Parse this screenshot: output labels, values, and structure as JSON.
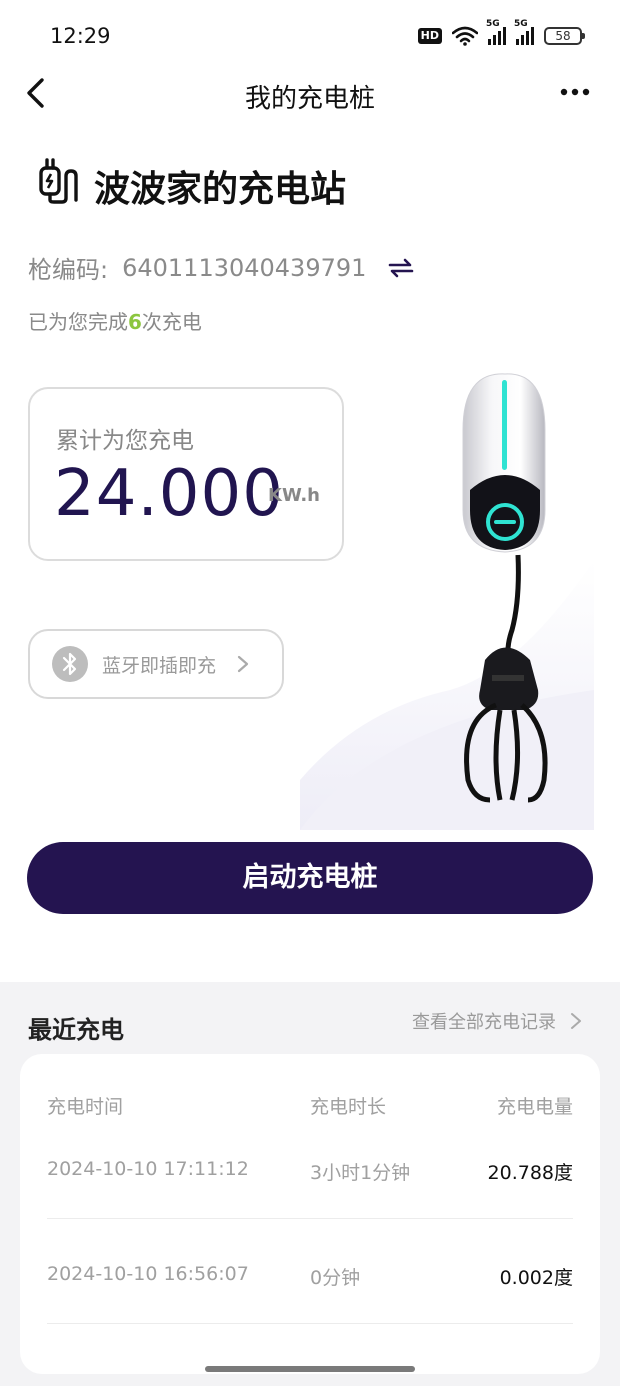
{
  "status_bar": {
    "time": "12:29",
    "hd_badge": "HD",
    "signal_1_tag": "5G",
    "signal_2_tag": "5G",
    "battery": "58",
    "icons": [
      "hd-icon",
      "wifi-icon",
      "signal-icon",
      "signal-icon",
      "battery-icon"
    ]
  },
  "nav": {
    "title": "我的充电桩",
    "back_icon": "chevron-left-icon",
    "more_icon": "more-dots-icon"
  },
  "station": {
    "icon": "charger-plug-icon",
    "name": "波波家的充电站",
    "gun_label": "枪编码:",
    "gun_code": "6401113040439791",
    "swap_icon": "swap-arrows-icon",
    "completed_prefix": "已为您完成",
    "completed_count": "6",
    "completed_suffix": "次充电"
  },
  "energy": {
    "label": "累计为您充电",
    "value": "24.000",
    "unit": "KW.h"
  },
  "bluetooth": {
    "label": "蓝牙即插即充",
    "icon": "bluetooth-icon"
  },
  "start_button": "启动充电桩",
  "recent": {
    "title": "最近充电",
    "view_all": "查看全部充电记录",
    "columns": {
      "time": "充电时间",
      "duration": "充电时长",
      "amount": "充电电量"
    },
    "records": [
      {
        "time": "2024-10-10  17:11:12",
        "duration": "3小时1分钟",
        "amount": "20.788度"
      },
      {
        "time": "2024-10-10  16:56:07",
        "duration": "0分钟",
        "amount": "0.002度"
      }
    ]
  },
  "colors": {
    "primary": "#241450",
    "energy_value": "#211550",
    "accent_green": "#8cc63f",
    "charger_glow": "#2fe3d2"
  }
}
